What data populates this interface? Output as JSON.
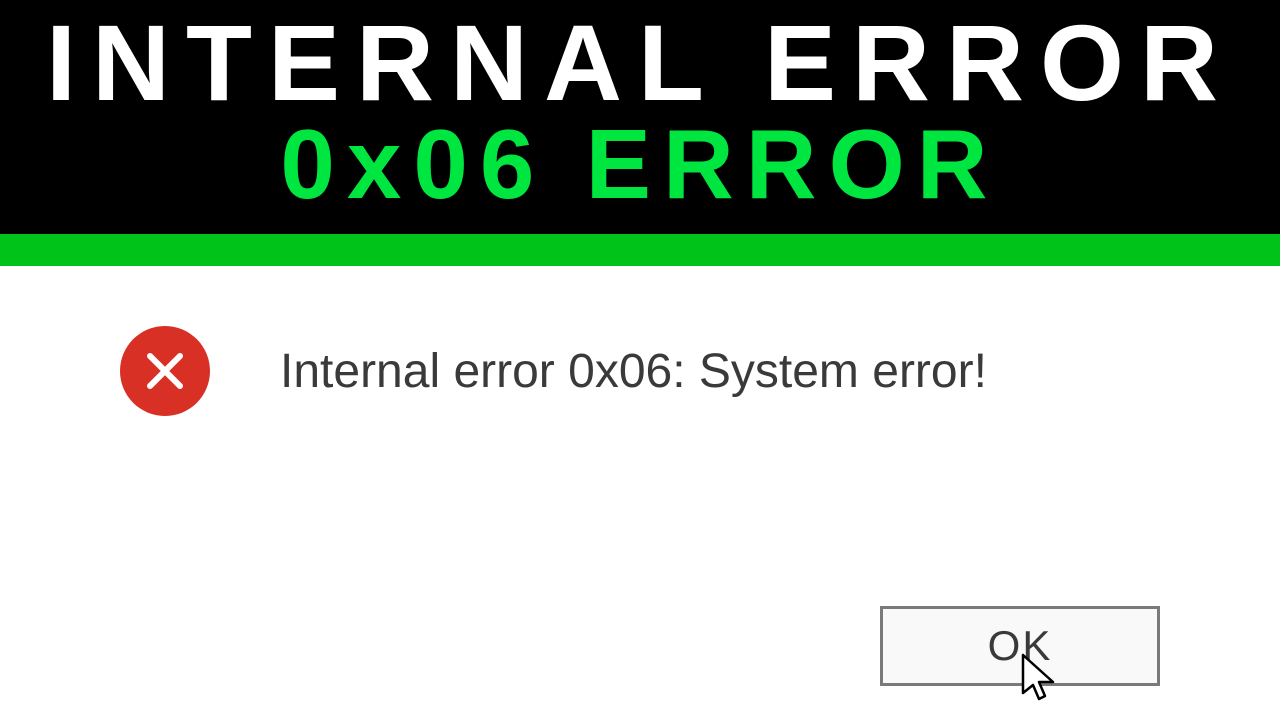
{
  "banner": {
    "line1": "INTERNAL ERROR",
    "line2": "0x06 ERROR"
  },
  "dialog": {
    "message": "Internal error 0x06: System error!",
    "ok_label": "OK",
    "icon_name": "error-x"
  },
  "colors": {
    "accent_green": "#00e640",
    "bar_green": "#00c31a",
    "error_red": "#d93025"
  }
}
